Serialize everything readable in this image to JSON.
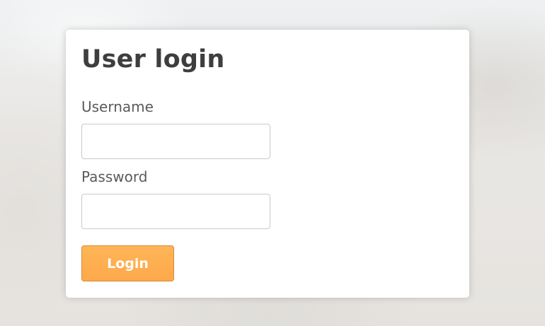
{
  "login_form": {
    "title": "User login",
    "username_label": "Username",
    "username_value": "",
    "password_label": "Password",
    "password_value": "",
    "submit_label": "Login"
  },
  "colors": {
    "accent": "#fdaa4c",
    "title_text": "#3e3e3e",
    "label_text": "#5a5a5a"
  }
}
